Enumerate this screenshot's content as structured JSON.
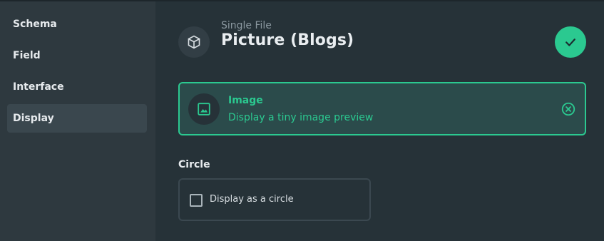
{
  "sidebar": {
    "items": [
      {
        "label": "Schema",
        "active": false
      },
      {
        "label": "Field",
        "active": false
      },
      {
        "label": "Interface",
        "active": false
      },
      {
        "label": "Display",
        "active": true
      }
    ]
  },
  "header": {
    "icon": "cube-icon",
    "subtitle": "Single File",
    "title": "Picture (Blogs)",
    "save_icon": "check-icon"
  },
  "display_option": {
    "icon": "image-icon",
    "title": "Image",
    "description": "Display a tiny image preview",
    "clear_icon": "close-circle-icon"
  },
  "circle_option": {
    "section_label": "Circle",
    "checkbox_label": "Display as a circle",
    "checked": false
  },
  "colors": {
    "accent": "#2bc990",
    "background": "#263238",
    "sidebar": "#2e393f",
    "active_nav": "#3a474e"
  }
}
